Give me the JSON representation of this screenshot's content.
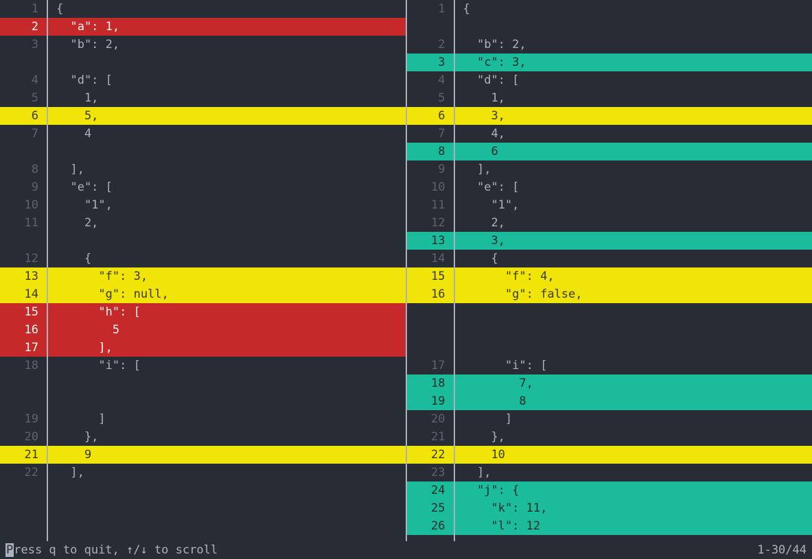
{
  "left_pane": {
    "rows": [
      {
        "n": "1",
        "text": "{",
        "cls": "normal"
      },
      {
        "n": "2",
        "text": "  \"a\": 1,",
        "cls": "removed"
      },
      {
        "n": "3",
        "text": "  \"b\": 2,",
        "cls": "normal"
      },
      {
        "n": "",
        "text": "",
        "cls": "normal"
      },
      {
        "n": "4",
        "text": "  \"d\": [",
        "cls": "normal"
      },
      {
        "n": "5",
        "text": "    1,",
        "cls": "normal"
      },
      {
        "n": "6",
        "text": "    5,",
        "cls": "changed"
      },
      {
        "n": "7",
        "text": "    4",
        "cls": "normal"
      },
      {
        "n": "",
        "text": "",
        "cls": "normal"
      },
      {
        "n": "8",
        "text": "  ],",
        "cls": "normal"
      },
      {
        "n": "9",
        "text": "  \"e\": [",
        "cls": "normal"
      },
      {
        "n": "10",
        "text": "    \"1\",",
        "cls": "normal"
      },
      {
        "n": "11",
        "text": "    2,",
        "cls": "normal"
      },
      {
        "n": "",
        "text": "",
        "cls": "normal"
      },
      {
        "n": "12",
        "text": "    {",
        "cls": "normal"
      },
      {
        "n": "13",
        "text": "      \"f\": 3,",
        "cls": "changed"
      },
      {
        "n": "14",
        "text": "      \"g\": null,",
        "cls": "changed"
      },
      {
        "n": "15",
        "text": "      \"h\": [",
        "cls": "removed"
      },
      {
        "n": "16",
        "text": "        5",
        "cls": "removed"
      },
      {
        "n": "17",
        "text": "      ],",
        "cls": "removed"
      },
      {
        "n": "18",
        "text": "      \"i\": [",
        "cls": "normal"
      },
      {
        "n": "",
        "text": "",
        "cls": "normal"
      },
      {
        "n": "",
        "text": "",
        "cls": "normal"
      },
      {
        "n": "19",
        "text": "      ]",
        "cls": "normal"
      },
      {
        "n": "20",
        "text": "    },",
        "cls": "normal"
      },
      {
        "n": "21",
        "text": "    9",
        "cls": "changed"
      },
      {
        "n": "22",
        "text": "  ],",
        "cls": "normal"
      },
      {
        "n": "",
        "text": "",
        "cls": "normal"
      },
      {
        "n": "",
        "text": "",
        "cls": "normal"
      },
      {
        "n": "",
        "text": "",
        "cls": "normal"
      }
    ]
  },
  "right_pane": {
    "rows": [
      {
        "n": "1",
        "text": "{",
        "cls": "normal"
      },
      {
        "n": "",
        "text": "",
        "cls": "normal"
      },
      {
        "n": "2",
        "text": "  \"b\": 2,",
        "cls": "normal"
      },
      {
        "n": "3",
        "text": "  \"c\": 3,",
        "cls": "added"
      },
      {
        "n": "4",
        "text": "  \"d\": [",
        "cls": "normal"
      },
      {
        "n": "5",
        "text": "    1,",
        "cls": "normal"
      },
      {
        "n": "6",
        "text": "    3,",
        "cls": "changed"
      },
      {
        "n": "7",
        "text": "    4,",
        "cls": "normal"
      },
      {
        "n": "8",
        "text": "    6",
        "cls": "added"
      },
      {
        "n": "9",
        "text": "  ],",
        "cls": "normal"
      },
      {
        "n": "10",
        "text": "  \"e\": [",
        "cls": "normal"
      },
      {
        "n": "11",
        "text": "    \"1\",",
        "cls": "normal"
      },
      {
        "n": "12",
        "text": "    2,",
        "cls": "normal"
      },
      {
        "n": "13",
        "text": "    3,",
        "cls": "added"
      },
      {
        "n": "14",
        "text": "    {",
        "cls": "normal"
      },
      {
        "n": "15",
        "text": "      \"f\": 4,",
        "cls": "changed"
      },
      {
        "n": "16",
        "text": "      \"g\": false,",
        "cls": "changed"
      },
      {
        "n": "",
        "text": "",
        "cls": "normal"
      },
      {
        "n": "",
        "text": "",
        "cls": "normal"
      },
      {
        "n": "",
        "text": "",
        "cls": "normal"
      },
      {
        "n": "17",
        "text": "      \"i\": [",
        "cls": "normal"
      },
      {
        "n": "18",
        "text": "        7,",
        "cls": "added"
      },
      {
        "n": "19",
        "text": "        8",
        "cls": "added"
      },
      {
        "n": "20",
        "text": "      ]",
        "cls": "normal"
      },
      {
        "n": "21",
        "text": "    },",
        "cls": "normal"
      },
      {
        "n": "22",
        "text": "    10",
        "cls": "changed"
      },
      {
        "n": "23",
        "text": "  ],",
        "cls": "normal"
      },
      {
        "n": "24",
        "text": "  \"j\": {",
        "cls": "added"
      },
      {
        "n": "25",
        "text": "    \"k\": 11,",
        "cls": "added"
      },
      {
        "n": "26",
        "text": "    \"l\": 12",
        "cls": "added"
      }
    ]
  },
  "statusbar": {
    "left_prefix_cursor": "P",
    "left_rest": "ress q to quit, ↑/↓ to scroll",
    "right": "1-30/44"
  }
}
